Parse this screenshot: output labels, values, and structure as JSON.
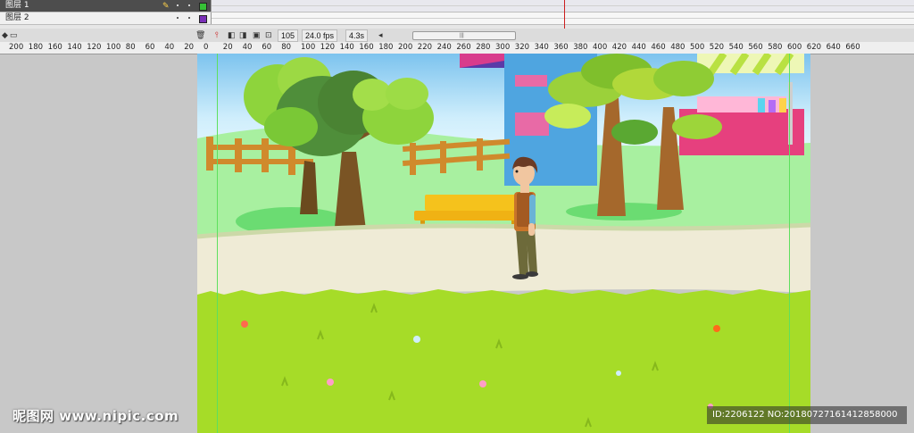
{
  "timeline": {
    "layers": [
      {
        "name": "图层 1",
        "selected": true,
        "color": "#36c136",
        "editing": true
      },
      {
        "name": "图层 2",
        "selected": false,
        "color": "#7a2fb8",
        "editing": false
      }
    ],
    "current_frame": "105",
    "frame_rate": "24.0 fps",
    "elapsed_time": "4.3s",
    "scroll_grip": "|||"
  },
  "ruler": {
    "labels": [
      "200",
      "180",
      "160",
      "140",
      "120",
      "100",
      "80",
      "60",
      "40",
      "20",
      "0",
      "20",
      "40",
      "60",
      "80",
      "100",
      "120",
      "140",
      "160",
      "180",
      "200",
      "220",
      "240",
      "260",
      "280",
      "300",
      "320",
      "340",
      "360",
      "380",
      "400",
      "420",
      "440",
      "460",
      "480",
      "500",
      "520",
      "540",
      "560",
      "580",
      "600",
      "620",
      "640",
      "660"
    ]
  },
  "stage": {
    "sky_color": "#a7d8f5",
    "grass_color": "#a6dc28",
    "path_color": "#efebd6"
  },
  "watermark": {
    "site": "昵图网 www.nipic.com",
    "id_text": "ID:2206122 NO:20180727161412858000"
  },
  "icons": {
    "pencil": "pencil-icon",
    "trash": "trash-icon"
  }
}
